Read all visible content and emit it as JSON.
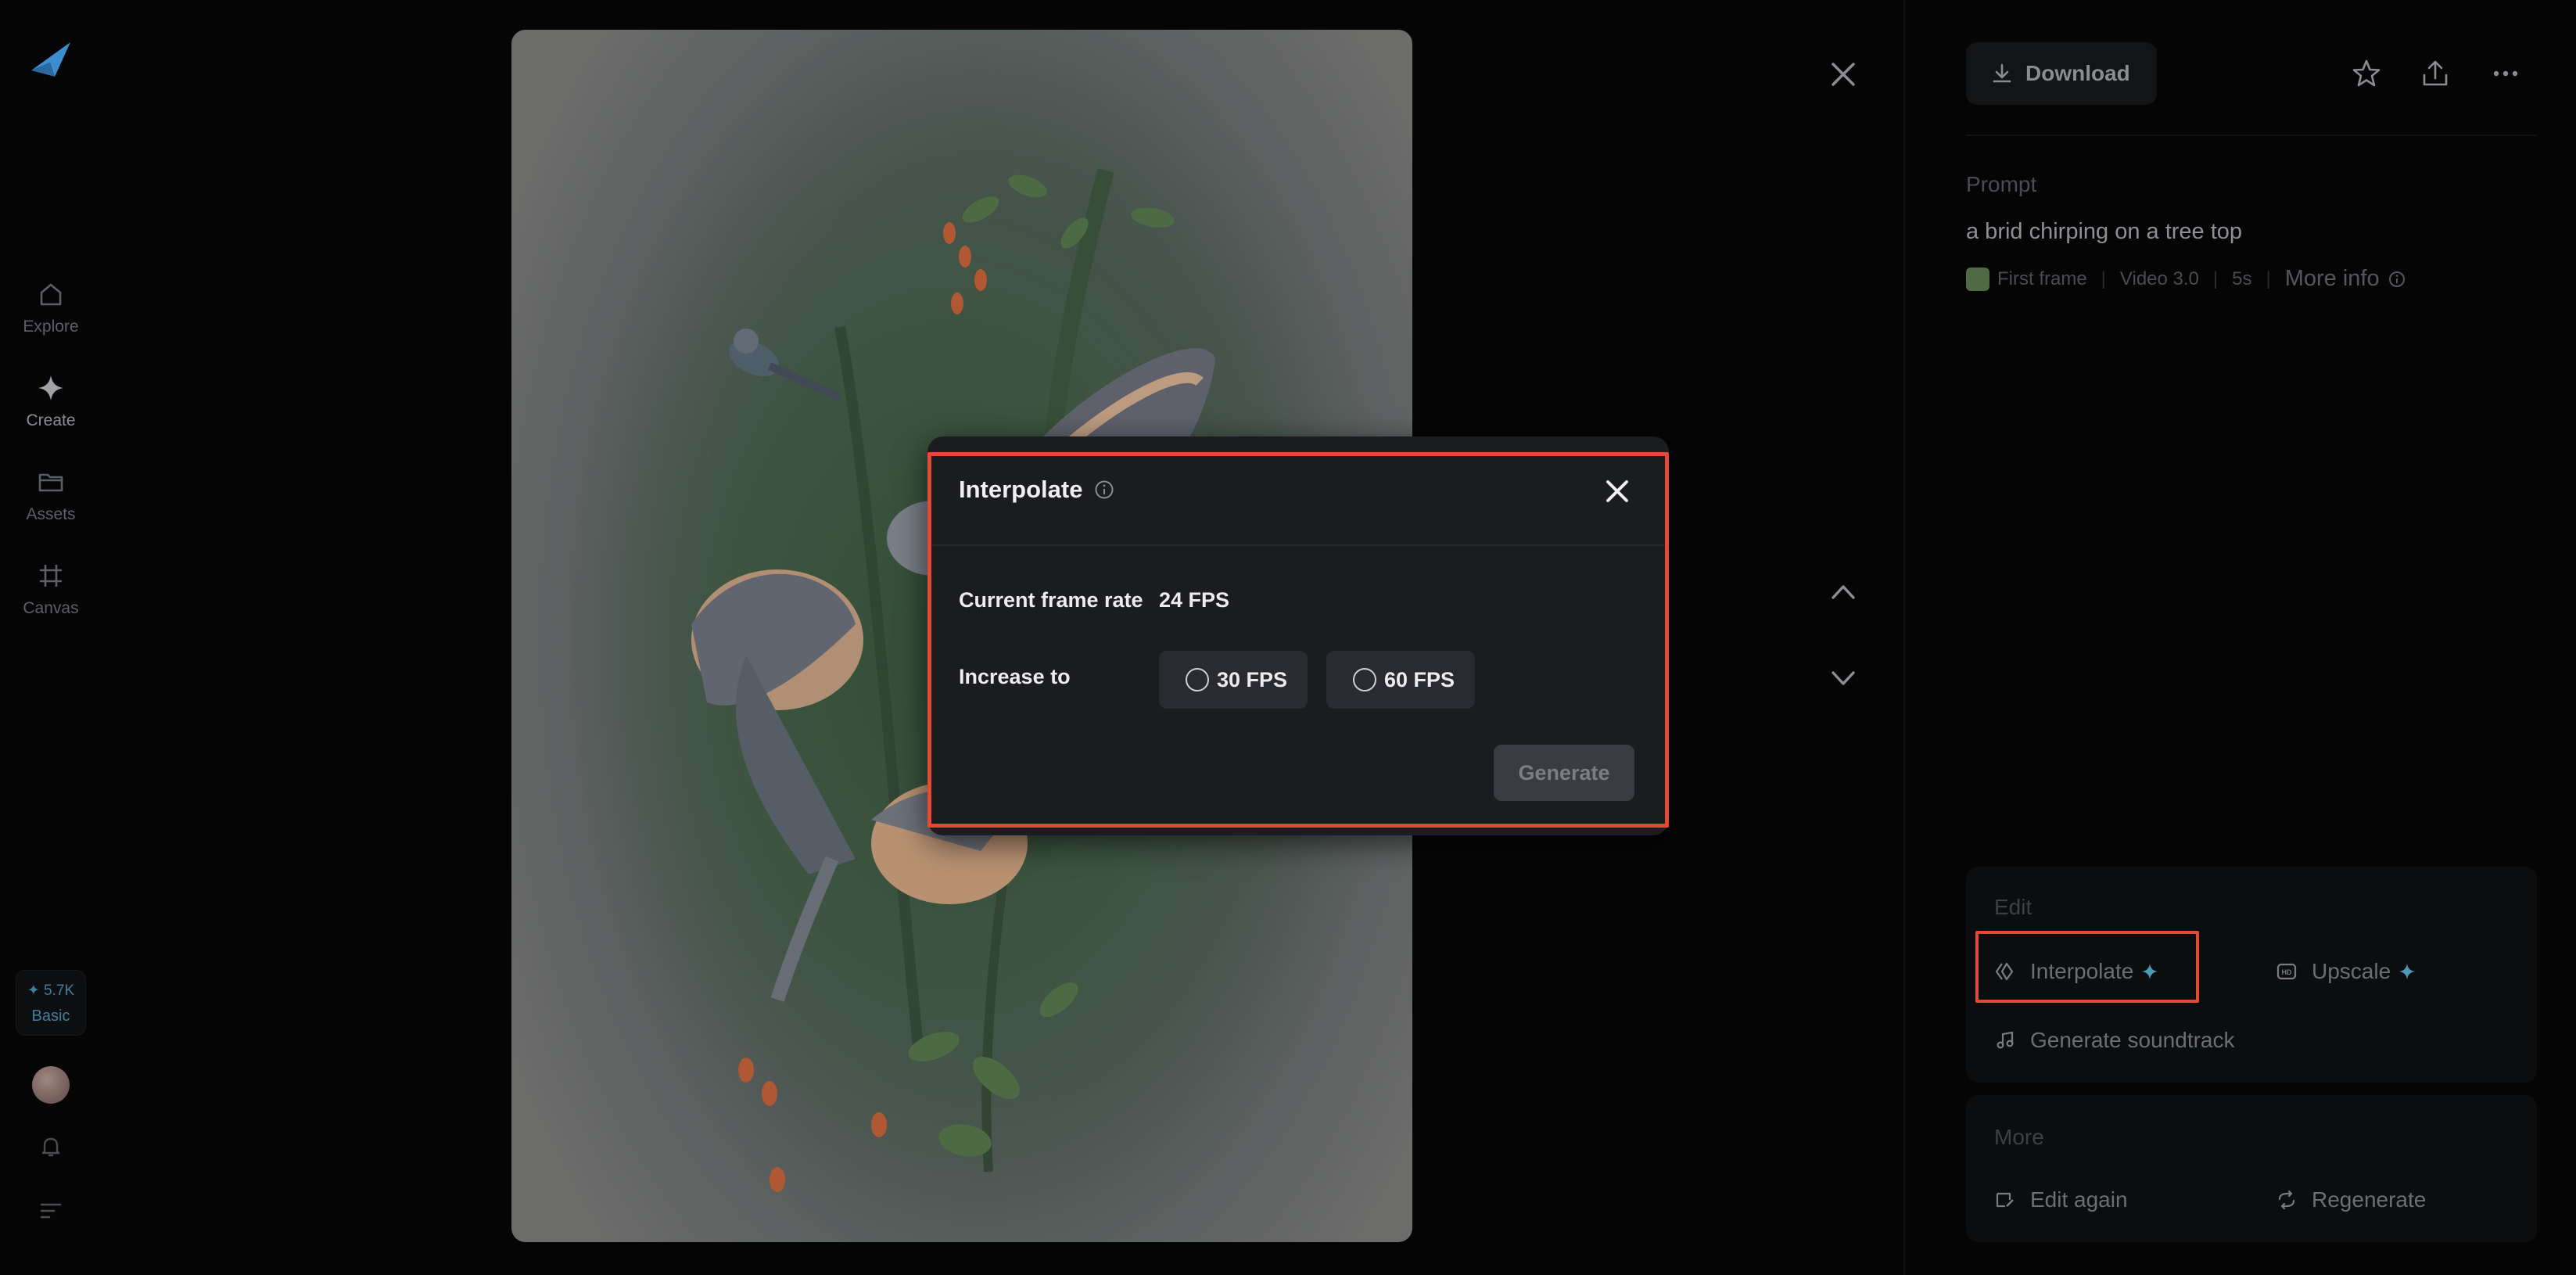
{
  "nav": {
    "items": [
      {
        "label": "Explore",
        "icon": "home-icon"
      },
      {
        "label": "Create",
        "icon": "sparkle-icon"
      },
      {
        "label": "Assets",
        "icon": "folder-icon"
      },
      {
        "label": "Canvas",
        "icon": "canvas-icon"
      }
    ],
    "credits": {
      "amount": "✦ 5.7K",
      "plan": "Basic"
    }
  },
  "artwork": {
    "description_icon": "bird-painting"
  },
  "right_panel": {
    "download_label": "Download",
    "prompt_label": "Prompt",
    "prompt_text": "a brid chirping on a tree top",
    "meta": {
      "first_frame": "First frame",
      "model": "Video 3.0",
      "duration": "5s",
      "more_info": "More info"
    },
    "edit": {
      "title": "Edit",
      "interpolate": "Interpolate",
      "upscale": "Upscale",
      "soundtrack": "Generate soundtrack"
    },
    "more": {
      "title": "More",
      "edit_again": "Edit again",
      "regenerate": "Regenerate"
    }
  },
  "dialog": {
    "title": "Interpolate",
    "current_label": "Current frame rate",
    "current_value": "24 FPS",
    "increase_label": "Increase to",
    "options": [
      "30 FPS",
      "60 FPS"
    ],
    "generate_label": "Generate"
  },
  "colors": {
    "accent_highlight": "#e24a36",
    "brand_blue": "#3b8fd0"
  }
}
